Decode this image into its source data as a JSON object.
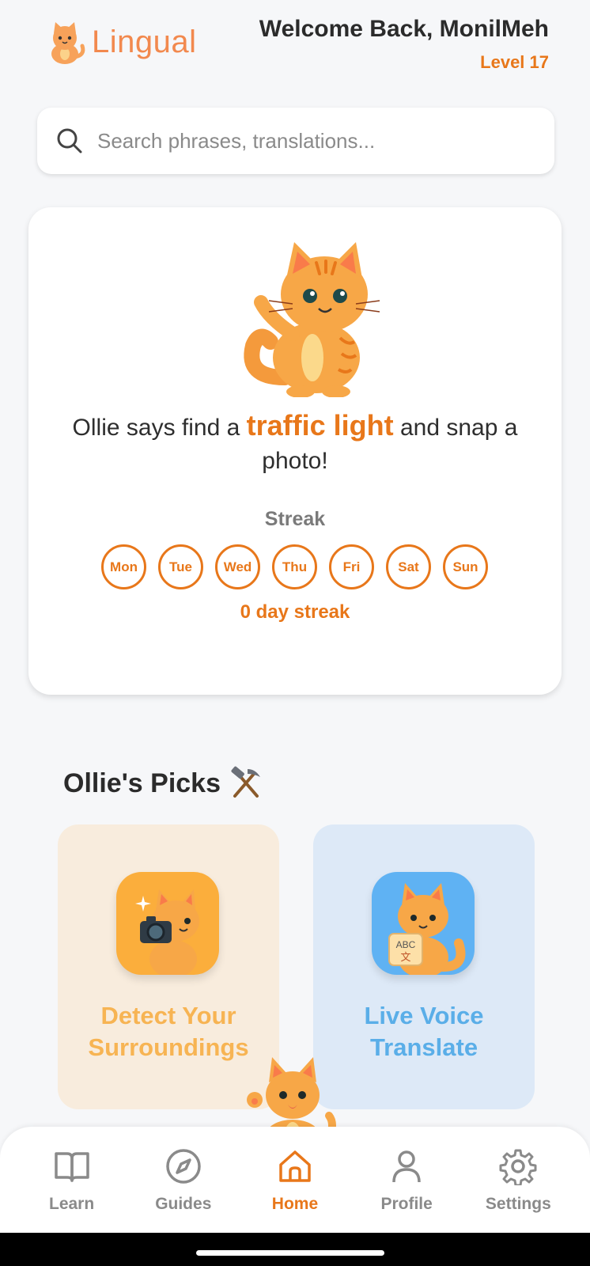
{
  "header": {
    "logo_text": "Lingual",
    "welcome_title": "Welcome Back, MonilMeh",
    "level": "Level 17"
  },
  "search": {
    "placeholder": "Search phrases, translations...",
    "value": ""
  },
  "challenge": {
    "prefix": "Ollie says find a ",
    "highlight": "traffic light",
    "suffix": " and snap a photo!",
    "streak_label": "Streak",
    "days": [
      "Mon",
      "Tue",
      "Wed",
      "Thu",
      "Fri",
      "Sat",
      "Sun"
    ],
    "streak_count": "0 day streak"
  },
  "picks": {
    "title": "Ollie's Picks",
    "title_icon": "hammer-and-pick-icon",
    "items": [
      {
        "label": "Detect Your Surroundings",
        "icon": "cat-camera-icon",
        "color": "#fbae3c"
      },
      {
        "label": "Live Voice Translate",
        "icon": "cat-abc-translate-icon",
        "color": "#5fb2f3"
      }
    ]
  },
  "nav": {
    "items": [
      {
        "label": "Learn",
        "icon": "book-icon"
      },
      {
        "label": "Guides",
        "icon": "compass-icon"
      },
      {
        "label": "Home",
        "icon": "home-icon"
      },
      {
        "label": "Profile",
        "icon": "person-icon"
      },
      {
        "label": "Settings",
        "icon": "gear-icon"
      }
    ],
    "active": "Home"
  },
  "colors": {
    "accent": "#e8771a",
    "background": "#f6f7f9",
    "detect_card": "#f8ecdd",
    "voice_card": "#dde9f7"
  }
}
